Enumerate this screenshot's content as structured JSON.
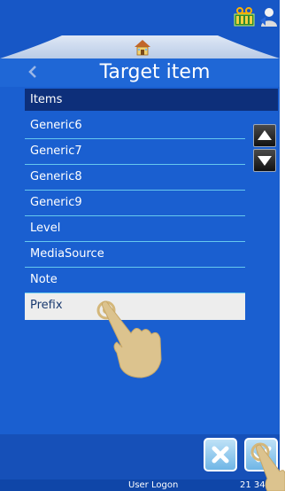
{
  "title_bar": {
    "title": "Target item"
  },
  "list": {
    "header": "Items",
    "items": [
      {
        "label": "Generic6"
      },
      {
        "label": "Generic7"
      },
      {
        "label": "Generic8"
      },
      {
        "label": "Generic9"
      },
      {
        "label": "Level"
      },
      {
        "label": "MediaSource"
      },
      {
        "label": "Note"
      },
      {
        "label": "Prefix",
        "selected": true
      }
    ]
  },
  "footer": {
    "user": "User Logon",
    "time": "21 34"
  },
  "icons": {
    "back": "chevron-left-icon",
    "home": "home-icon",
    "tape": "tape-cassette-icon",
    "user": "user-icon",
    "scroll_up": "triangle-up-icon",
    "scroll_down": "triangle-down-icon",
    "cancel": "x-icon",
    "confirm": "check-icon"
  },
  "colors": {
    "background": "#1a5fd0",
    "header_bg": "#0d2f7a",
    "separator": "#66c8ee",
    "selected_bg": "#ededed"
  }
}
